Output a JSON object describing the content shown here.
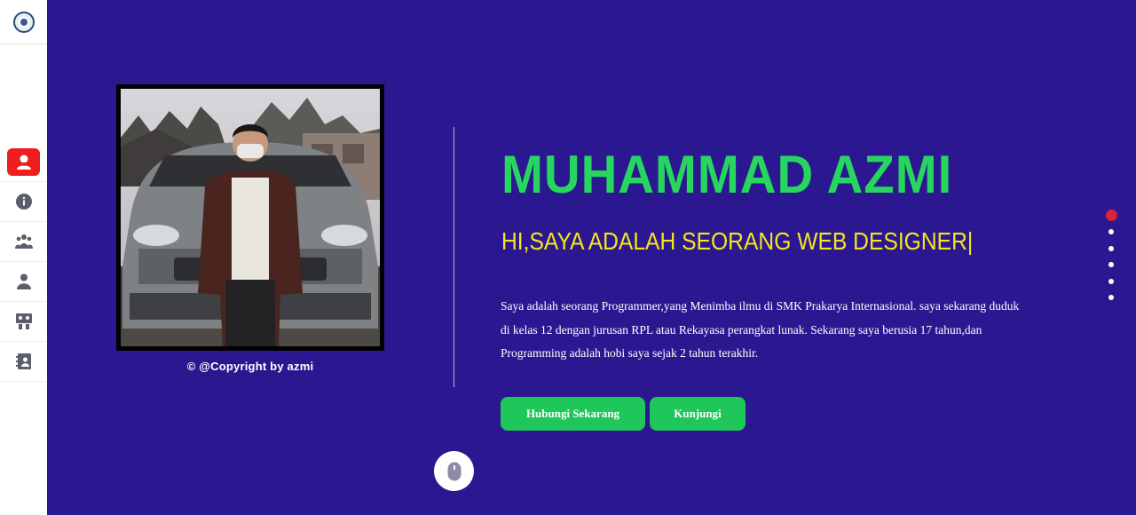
{
  "profile": {
    "name": "MUHAMMAD AZMI",
    "subtitle": "HI,SAYA ADALAH SEORANG WEB DESIGNER|",
    "description": "Saya adalah seorang Programmer,yang Menimba ilmu di SMK Prakarya Internasional. saya sekarang duduk di kelas 12 dengan jurusan RPL atau Rekayasa perangkat lunak. Sekarang saya berusia 17 tahun,dan Programming adalah hobi saya sejak 2 tahun terakhir.",
    "copyright": "© @Copyright by azmi"
  },
  "buttons": {
    "contact_label": "Hubungi Sekarang",
    "visit_label": "Kunjungi"
  },
  "sidebar": {
    "items": [
      {
        "icon": "home-user-icon",
        "active": true
      },
      {
        "icon": "info-icon",
        "active": false
      },
      {
        "icon": "team-icon",
        "active": false
      },
      {
        "icon": "user-icon",
        "active": false
      },
      {
        "icon": "presentation-icon",
        "active": false
      },
      {
        "icon": "contact-book-icon",
        "active": false
      }
    ]
  },
  "pagination": {
    "count": 6,
    "active_index": 0
  },
  "colors": {
    "background": "#2b1890",
    "accent_green": "#27d65f",
    "accent_yellow": "#f7e51c",
    "active_red": "#ef1d1d"
  }
}
